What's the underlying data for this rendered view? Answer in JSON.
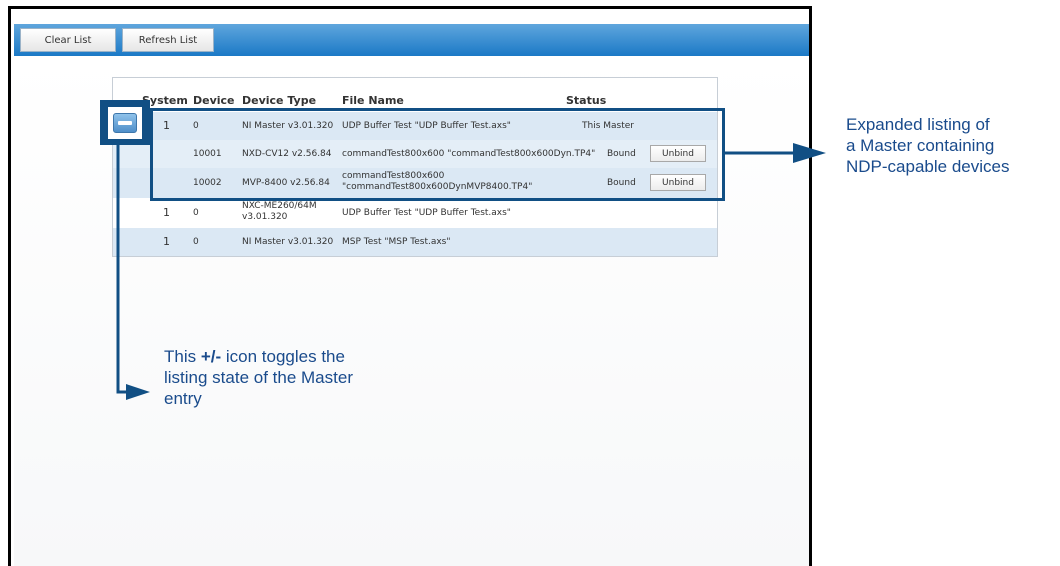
{
  "toolbar": {
    "clear_label": "Clear List",
    "refresh_label": "Refresh List"
  },
  "table": {
    "headers": {
      "system": "System",
      "device": "Device",
      "device_type": "Device Type",
      "file_name": "File Name",
      "status": "Status"
    },
    "rows": [
      {
        "system": "1",
        "device": "0",
        "device_type": "NI Master v3.01.320",
        "file_name": "UDP Buffer Test \"UDP Buffer Test.axs\"",
        "status": "This Master",
        "action": ""
      },
      {
        "system": "",
        "device": "10001",
        "device_type": "NXD-CV12 v2.56.84",
        "file_name": "commandTest800x600 \"commandTest800x600Dyn.TP4\"",
        "status": "Bound",
        "action": "Unbind"
      },
      {
        "system": "",
        "device": "10002",
        "device_type": "MVP-8400 v2.56.84",
        "file_name_line1": "commandTest800x600",
        "file_name_line2": "\"commandTest800x600DynMVP8400.TP4\"",
        "status": "Bound",
        "action": "Unbind"
      },
      {
        "system": "1",
        "device": "0",
        "device_type_line1": "NXC-ME260/64M",
        "device_type_line2": "v3.01.320",
        "file_name": "UDP Buffer Test \"UDP Buffer Test.axs\"",
        "status": "",
        "action": ""
      },
      {
        "system": "1",
        "device": "0",
        "device_type": "NI Master v3.01.320",
        "file_name": "MSP Test \"MSP Test.axs\"",
        "status": "",
        "action": ""
      }
    ]
  },
  "annotations": {
    "right_line1": "Expanded listing of",
    "right_line2": "a Master containing",
    "right_line3": "NDP-capable devices",
    "left_pre": "This ",
    "left_bold": "+/-",
    "left_post": " icon toggles the",
    "left_line2": "listing state of the Master",
    "left_line3": "entry"
  },
  "colors": {
    "toolbar": "#1b79c6",
    "callout": "#114f84",
    "row_alt": "#dbe8f4"
  },
  "icons": {
    "toggle": "minus-toggle-icon"
  }
}
